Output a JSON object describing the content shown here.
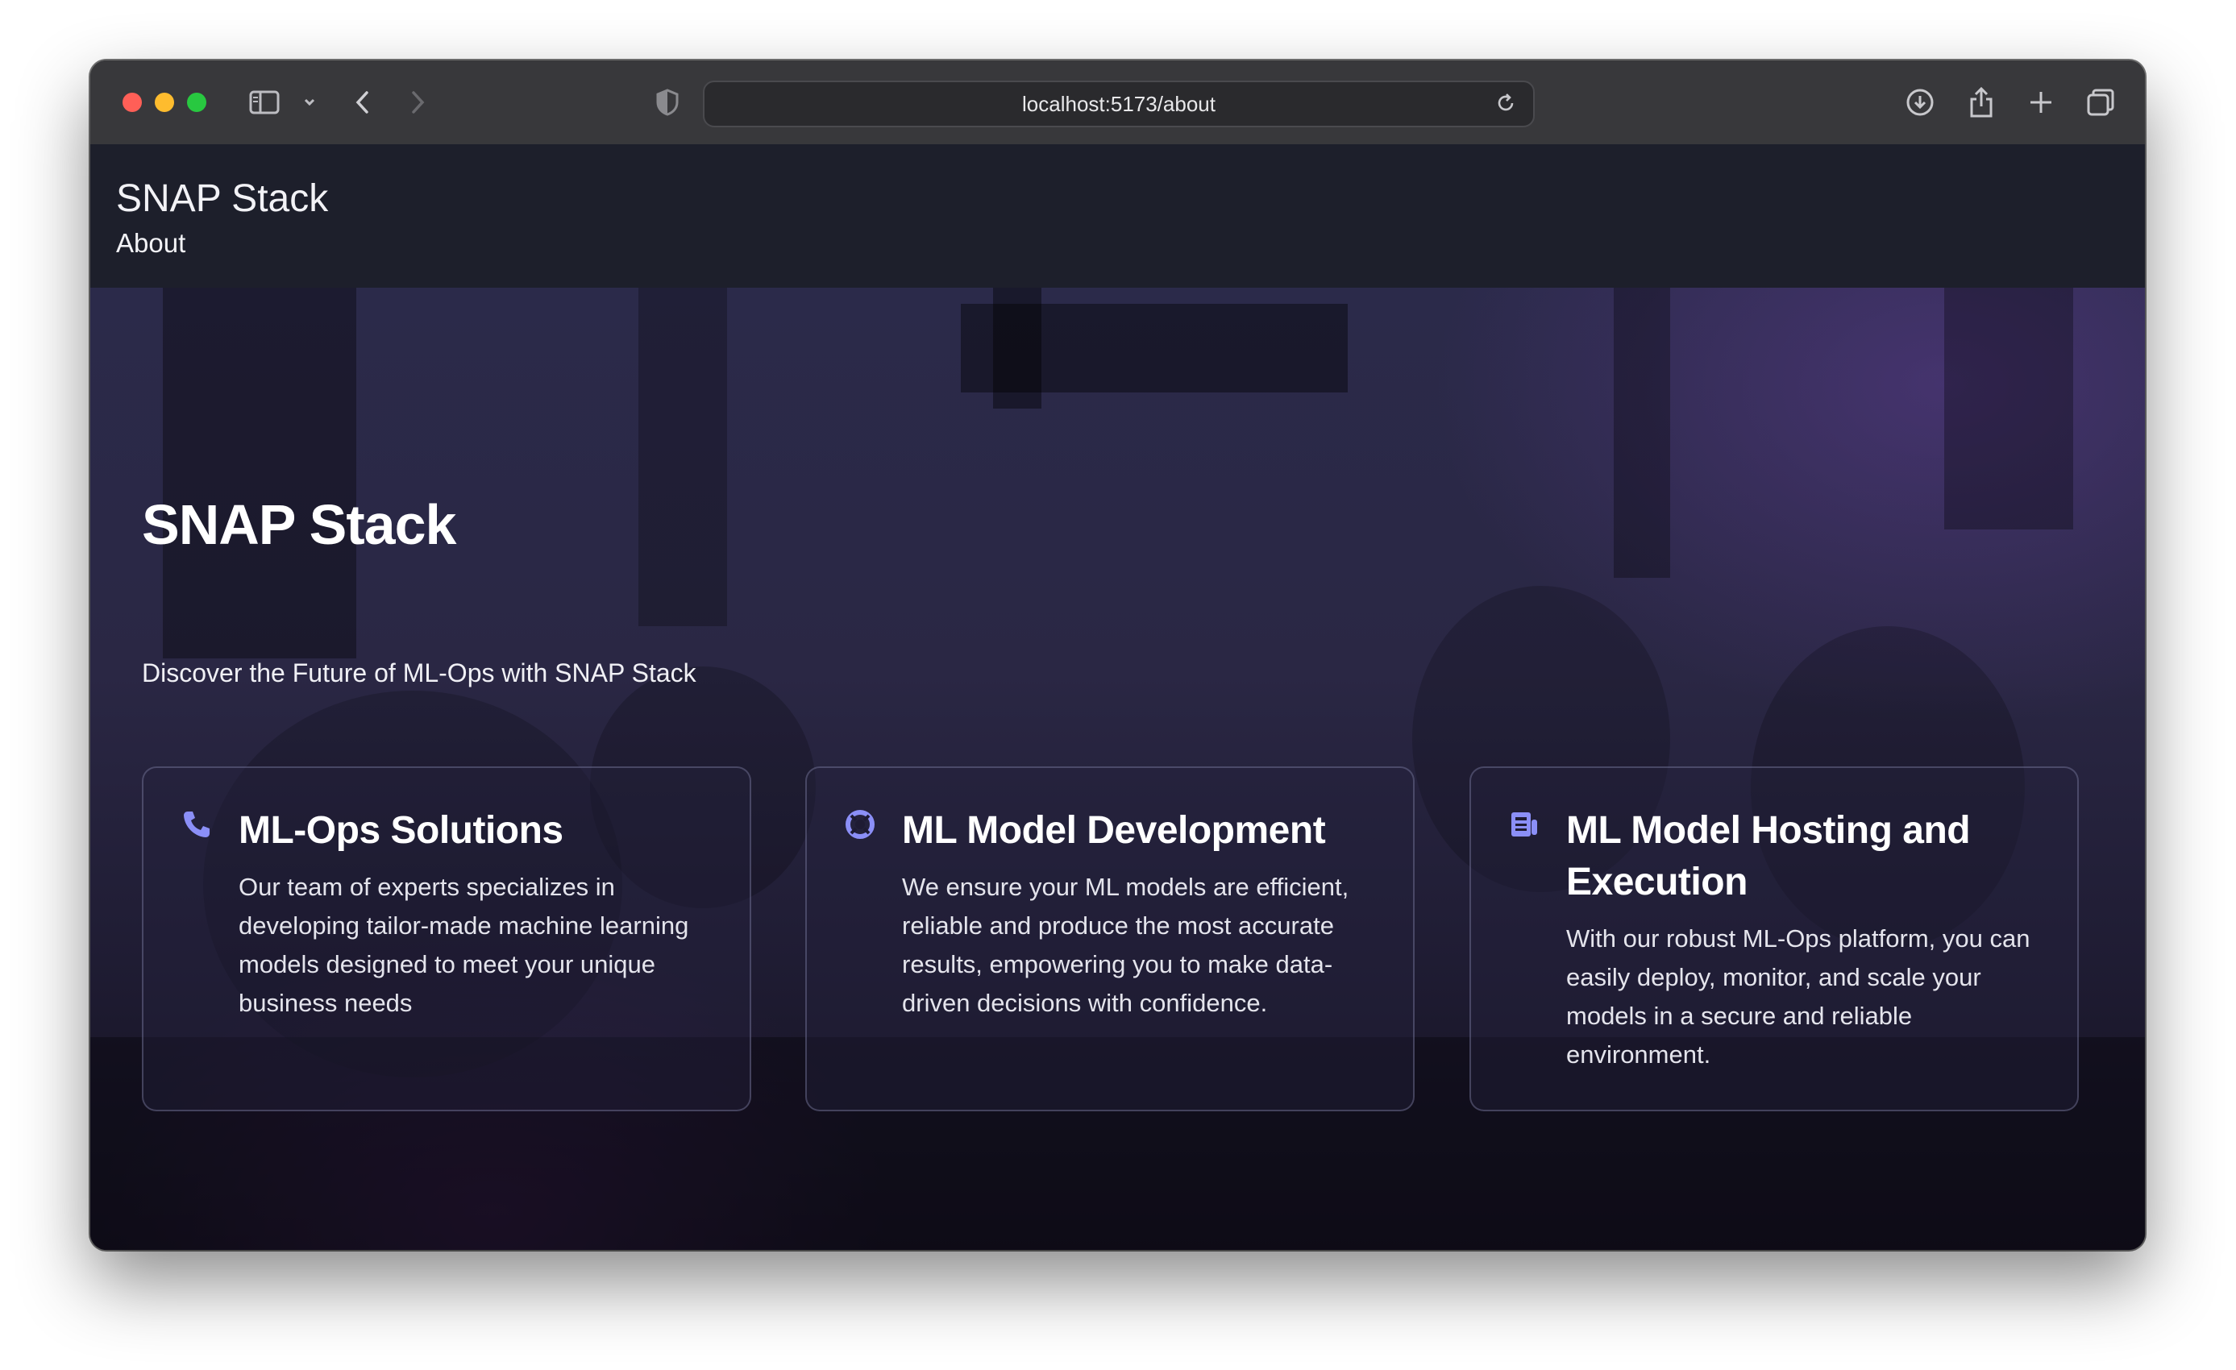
{
  "browser": {
    "url": "localhost:5173/about",
    "icons": [
      "sidebar-icon",
      "chevron-down-icon",
      "back-icon",
      "forward-icon",
      "shield-icon",
      "reload-icon",
      "download-icon",
      "share-icon",
      "new-tab-icon",
      "tabs-overview-icon"
    ]
  },
  "header": {
    "title": "SNAP Stack",
    "nav": [
      "About"
    ]
  },
  "hero": {
    "title": "SNAP Stack",
    "subtitle": "Discover the Future of ML-Ops with SNAP Stack"
  },
  "features": [
    {
      "icon": "phone-icon",
      "title": "ML-Ops Solutions",
      "description": "Our team of experts specializes in developing tailor-made machine learning models designed to meet your unique business needs"
    },
    {
      "icon": "lifebuoy-icon",
      "title": "ML Model Development",
      "description": "We ensure your ML models are efficient, reliable and produce the most accurate results, empowering you to make data-driven decisions with confidence."
    },
    {
      "icon": "newspaper-icon",
      "title": "ML Model Hosting and Execution",
      "description": "With our robust ML-Ops platform, you can easily deploy, monitor, and scale your models in a secure and reliable environment."
    }
  ],
  "colors": {
    "accent_icon": "#8b8ff7",
    "header_bg": "#1d1f2b",
    "toolbar_bg": "#38383b"
  }
}
